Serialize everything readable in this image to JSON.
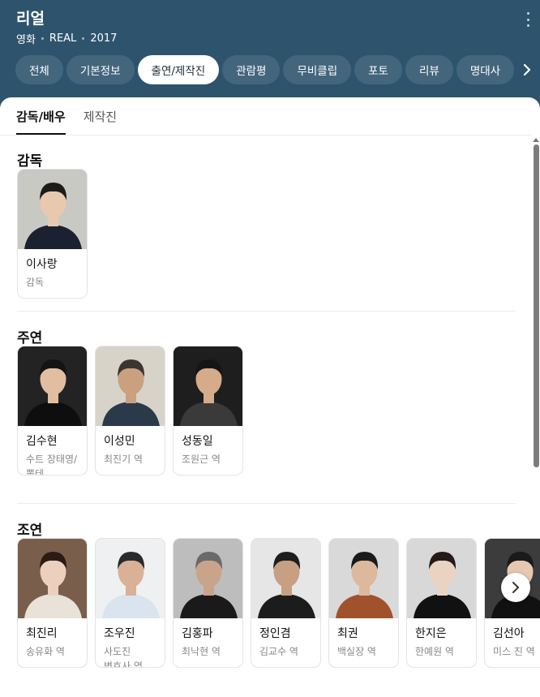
{
  "header": {
    "title": "리얼",
    "genre": "영화",
    "original_title": "REAL",
    "year": "2017"
  },
  "tabs": [
    "전체",
    "기본정보",
    "출연/제작진",
    "관람평",
    "무비클립",
    "포토",
    "리뷰",
    "명대사"
  ],
  "active_tab": "출연/제작진",
  "subtabs": [
    "감독/배우",
    "제작진"
  ],
  "active_subtab": "감독/배우",
  "sections": {
    "director": {
      "title": "감독",
      "people": [
        {
          "name": "이사랑",
          "role": "감독",
          "bg": "#c9c9c4",
          "skin": "#e9c9ad",
          "hair": "#1d1b19",
          "cloth": "#1b2130"
        }
      ]
    },
    "lead": {
      "title": "주연",
      "people": [
        {
          "name": "김수현",
          "role": "수트 장태영/뽈테 ...",
          "bg": "#232323",
          "skin": "#e2bea1",
          "hair": "#141414",
          "cloth": "#0e0e0e"
        },
        {
          "name": "이성민",
          "role": "최진기 역",
          "bg": "#d7d3c8",
          "skin": "#caa07f",
          "hair": "#3a3530",
          "cloth": "#2a3a4a"
        },
        {
          "name": "성동일",
          "role": "조원근 역",
          "bg": "#1e1e1e",
          "skin": "#d6ab8a",
          "hair": "#151515",
          "cloth": "#3a3a3a"
        }
      ]
    },
    "support": {
      "title": "조연",
      "people": [
        {
          "name": "최진리",
          "role": "송유화 역",
          "bg": "#7a5e4c",
          "skin": "#ecd0bd",
          "hair": "#2a1b15",
          "cloth": "#e8e2d8"
        },
        {
          "name": "조우진",
          "role": "사도진 변호사 역",
          "bg": "#eef0f2",
          "skin": "#d8b197",
          "hair": "#2a2a2a",
          "cloth": "#d9e4ee"
        },
        {
          "name": "김홍파",
          "role": "최낙현 역",
          "bg": "#bdbdbd",
          "skin": "#caa48a",
          "hair": "#6a6a6a",
          "cloth": "#1a1a1a"
        },
        {
          "name": "정인겸",
          "role": "김교수 역",
          "bg": "#e6e6e6",
          "skin": "#c79f83",
          "hair": "#1e1e1e",
          "cloth": "#1c1c1c"
        },
        {
          "name": "최권",
          "role": "백실장 역",
          "bg": "#d9d9d9",
          "skin": "#dcb89c",
          "hair": "#1a1a1a",
          "cloth": "#a0522d"
        },
        {
          "name": "한지은",
          "role": "한예원 역",
          "bg": "#d8d8d8",
          "skin": "#ebd3c1",
          "hair": "#241a17",
          "cloth": "#111111"
        },
        {
          "name": "김선아",
          "role": "미스 진 역",
          "bg": "#3c3c3c",
          "skin": "#e6c8b0",
          "hair": "#1a1a1a",
          "cloth": "#111111"
        }
      ]
    }
  },
  "icons": {
    "more": "more-vertical-icon",
    "tabs_next": "chevron-right-icon",
    "row_next": "chevron-right-icon"
  },
  "colors": {
    "header_bg": "#2e546d",
    "tab_bg": "#43667d",
    "active_tab_bg": "#ffffff"
  }
}
